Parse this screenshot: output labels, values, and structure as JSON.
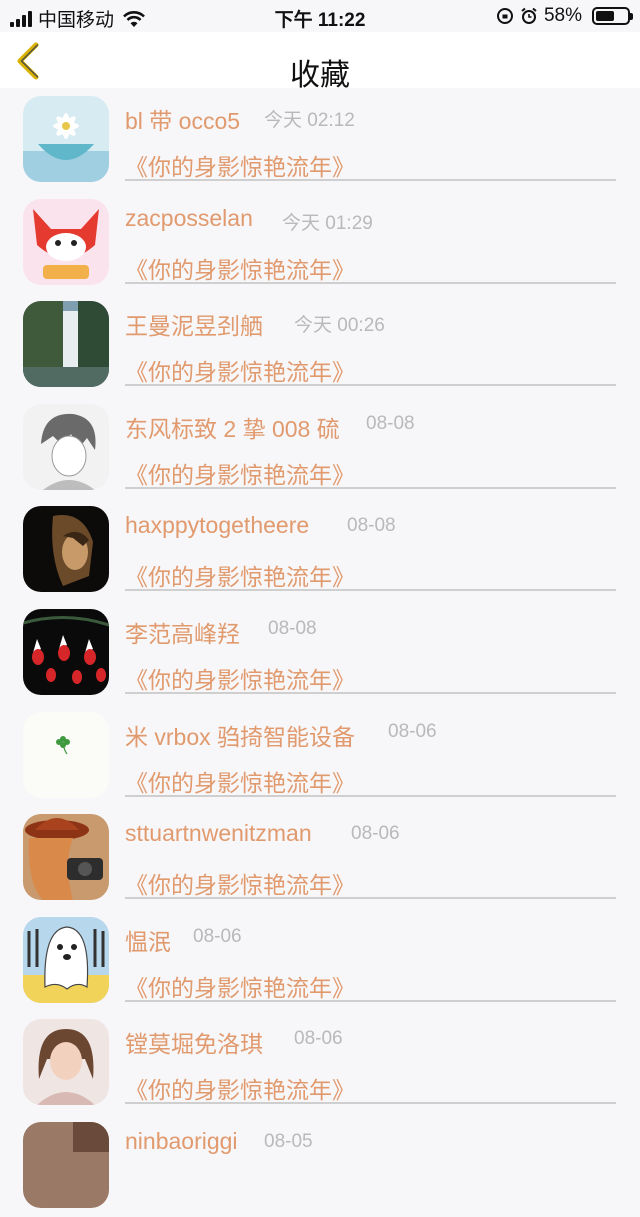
{
  "status_bar": {
    "carrier": "中国移动",
    "time": "下午 11:22",
    "battery_percent": "58%"
  },
  "nav": {
    "title": "收藏"
  },
  "items": [
    {
      "name": "bl 带 occo5",
      "time": "今天 02:12",
      "subtitle": "《你的身影惊艳流年》"
    },
    {
      "name": "zacposselan",
      "time": "今天 01:29",
      "subtitle": "《你的身影惊艳流年》"
    },
    {
      "name": "王曼泥昱刭舾",
      "time": "今天 00:26",
      "subtitle": "《你的身影惊艳流年》"
    },
    {
      "name": "东风标致 2 挚 008 硫",
      "time": "08-08",
      "subtitle": "《你的身影惊艳流年》"
    },
    {
      "name": "haxppytogetheere",
      "time": "08-08",
      "subtitle": "《你的身影惊艳流年》"
    },
    {
      "name": "李范高峰羟",
      "time": "08-08",
      "subtitle": "《你的身影惊艳流年》"
    },
    {
      "name": "米 vrbox 驺掎智能设备",
      "time": "08-06",
      "subtitle": "《你的身影惊艳流年》"
    },
    {
      "name": "sttuartnwenitzman",
      "time": "08-06",
      "subtitle": "《你的身影惊艳流年》"
    },
    {
      "name": "愠泯",
      "time": "08-06",
      "subtitle": "《你的身影惊艳流年》"
    },
    {
      "name": "镗莫堀免洛琪",
      "time": "08-06",
      "subtitle": "《你的身影惊艳流年》"
    },
    {
      "name": "ninbaoriggi",
      "time": "08-05",
      "subtitle": ""
    }
  ],
  "colors": {
    "accent": "#e19a6d",
    "time_gray": "#b9b9b9",
    "back_arrow": "#d9b200"
  }
}
